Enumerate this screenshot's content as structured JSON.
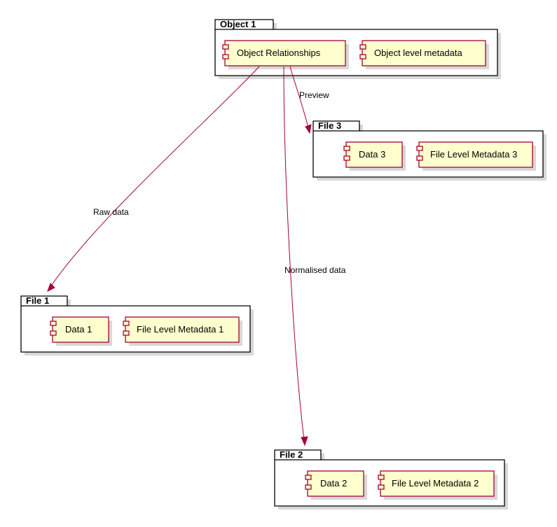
{
  "packages": {
    "object1": {
      "label": "Object 1"
    },
    "file1": {
      "label": "File 1"
    },
    "file2": {
      "label": "File 2"
    },
    "file3": {
      "label": "File 3"
    }
  },
  "components": {
    "obj_rel": {
      "label": "Object Relationships"
    },
    "obj_meta": {
      "label": "Object level metadata"
    },
    "data1": {
      "label": "Data 1"
    },
    "file_meta1": {
      "label": "File Level Metadata 1"
    },
    "data2": {
      "label": "Data 2"
    },
    "file_meta2": {
      "label": "File Level Metadata 2"
    },
    "data3": {
      "label": "Data 3"
    },
    "file_meta3": {
      "label": "File Level Metadata 3"
    }
  },
  "edges": {
    "raw": {
      "label": "Raw data"
    },
    "norm": {
      "label": "Normalised data"
    },
    "preview": {
      "label": "Preview"
    }
  }
}
